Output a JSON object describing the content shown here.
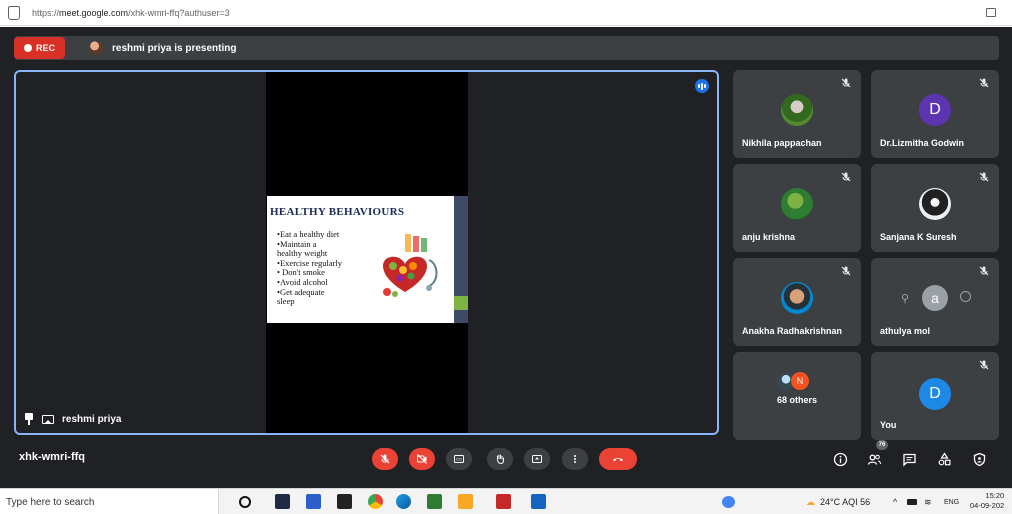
{
  "browser": {
    "url_prefix": "https://",
    "url_host": "meet.google.com",
    "url_path": "/xhk-wmri-ffq?authuser=3"
  },
  "topbar": {
    "rec_label": "REC",
    "presenting_text": "reshmi priya is presenting"
  },
  "stage": {
    "presenter_name": "reshmi priya",
    "slide": {
      "title": "HEALTHY BEHAVIOURS",
      "bullets": [
        "•Eat a healthy diet",
        "•Maintain a",
        "healthy weight",
        "•Exercise regularly",
        "• Don't smoke",
        "•Avoid alcohol",
        "•Get adequate",
        "sleep"
      ]
    }
  },
  "participants": [
    {
      "name": "Nikhila pappachan",
      "avatar": "photo-nature",
      "muted": true
    },
    {
      "name": "Dr.Lizmitha Godwin",
      "avatar": "D",
      "avatar_color": "#5e35b1",
      "muted": true
    },
    {
      "name": "anju krishna",
      "avatar": "photo-tree",
      "muted": true
    },
    {
      "name": "Sanjana K Suresh",
      "avatar": "photo-person",
      "muted": true
    },
    {
      "name": "Anakha Radhakrishnan",
      "avatar": "photo-face",
      "muted": true
    },
    {
      "name": "athulya mol",
      "avatar": "a",
      "avatar_color": "#9aa0a6",
      "muted": true
    },
    {
      "name": "68 others",
      "avatar": "N",
      "avatar_color": "#f4511e"
    },
    {
      "name": "You",
      "avatar": "D",
      "avatar_color": "#1e88e5",
      "muted": true
    }
  ],
  "bottom": {
    "meeting_code": "xhk-wmri-ffq",
    "people_count": "76"
  },
  "taskbar": {
    "search_placeholder": "Type here to search",
    "weather": "24°C AQI 56",
    "lang": "ENG",
    "time": "15:20",
    "date": "04-09-202"
  },
  "colors": {
    "surface": "#202124",
    "tile": "#3c4043",
    "accent": "#8ab4f8",
    "danger": "#ea4335"
  }
}
